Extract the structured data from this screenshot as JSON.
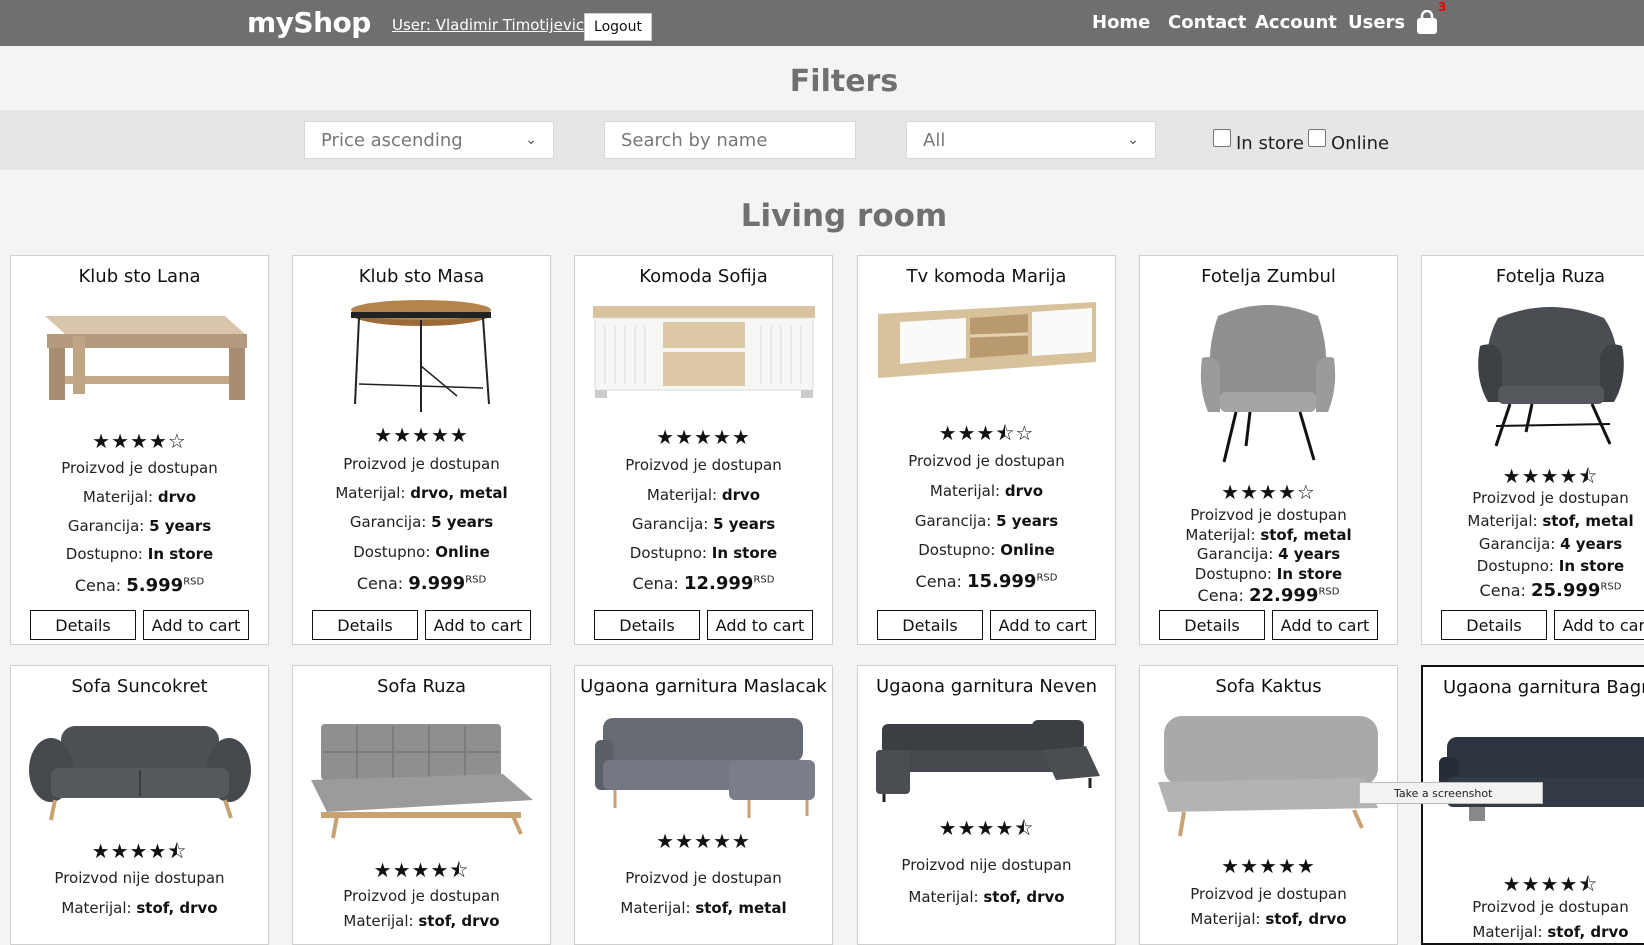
{
  "nav": {
    "logo": "myShop",
    "user": "User: Vladimir Timotijevic",
    "logout": "Logout",
    "links": [
      "Home",
      "Contact",
      "Account",
      "Users"
    ],
    "cart_count": "3"
  },
  "filters": {
    "title": "Filters",
    "sort_selected": "Price ascending",
    "search_placeholder": "Search by name",
    "category_selected": "All",
    "in_store": "In store",
    "online": "Online"
  },
  "section": {
    "title": "Living room"
  },
  "labels": {
    "material": "Materijal: ",
    "warranty": "Garancija: ",
    "available": "Dostupno: ",
    "price": "Cena: ",
    "currency": "RSD",
    "details": "Details",
    "add_to_cart": "Add to cart"
  },
  "products": [
    {
      "name": "Klub sto Lana",
      "stars": "★★★★☆",
      "rating": 4,
      "status": "Proizvod je dostupan",
      "material": "drvo",
      "warranty": "5 years",
      "availability": "In store",
      "price": "5.999"
    },
    {
      "name": "Klub sto Masa",
      "stars": "★★★★★",
      "rating": 5,
      "status": "Proizvod je dostupan",
      "material": "drvo, metal",
      "warranty": "5 years",
      "availability": "Online",
      "price": "9.999"
    },
    {
      "name": "Komoda Sofija",
      "stars": "★★★★★",
      "rating": 5,
      "status": "Proizvod je dostupan",
      "material": "drvo",
      "warranty": "5 years",
      "availability": "In store",
      "price": "12.999"
    },
    {
      "name": "Tv komoda Marija",
      "stars": "★★★⯪☆",
      "rating": 3.5,
      "status": "Proizvod je dostupan",
      "material": "drvo",
      "warranty": "5 years",
      "availability": "Online",
      "price": "15.999"
    },
    {
      "name": "Fotelja Zumbul",
      "stars": "★★★★☆",
      "rating": 4,
      "status": "Proizvod je dostupan",
      "material": "stof, metal",
      "warranty": "4 years",
      "availability": "In store",
      "price": "22.999"
    },
    {
      "name": "Fotelja Ruza",
      "stars": "★★★★⯪",
      "rating": 4.5,
      "status": "Proizvod je dostupan",
      "material": "stof, metal",
      "warranty": "4 years",
      "availability": "In store",
      "price": "25.999"
    },
    {
      "name": "Sofa Suncokret",
      "stars": "★★★★⯪",
      "rating": 4.5,
      "status": "Proizvod nije dostupan",
      "material": "stof, drvo"
    },
    {
      "name": "Sofa Ruza",
      "stars": "★★★★⯪",
      "rating": 4.5,
      "status": "Proizvod je dostupan",
      "material": "stof, drvo"
    },
    {
      "name": "Ugaona garnitura Maslacak",
      "stars": "★★★★★",
      "rating": 5,
      "status": "Proizvod je dostupan",
      "material": "stof, metal"
    },
    {
      "name": "Ugaona garnitura Neven",
      "stars": "★★★★⯪",
      "rating": 4.5,
      "status": "Proizvod nije dostupan",
      "material": "stof, drvo"
    },
    {
      "name": "Sofa Kaktus",
      "stars": "★★★★★",
      "rating": 5,
      "status": "Proizvod je dostupan",
      "material": "stof, drvo"
    },
    {
      "name": "Ugaona garnitura Bagrem",
      "stars": "★★★★⯪",
      "rating": 4.5,
      "status": "Proizvod je dostupan",
      "material": "stof, drvo"
    }
  ],
  "tooltip": "Take a screenshot"
}
